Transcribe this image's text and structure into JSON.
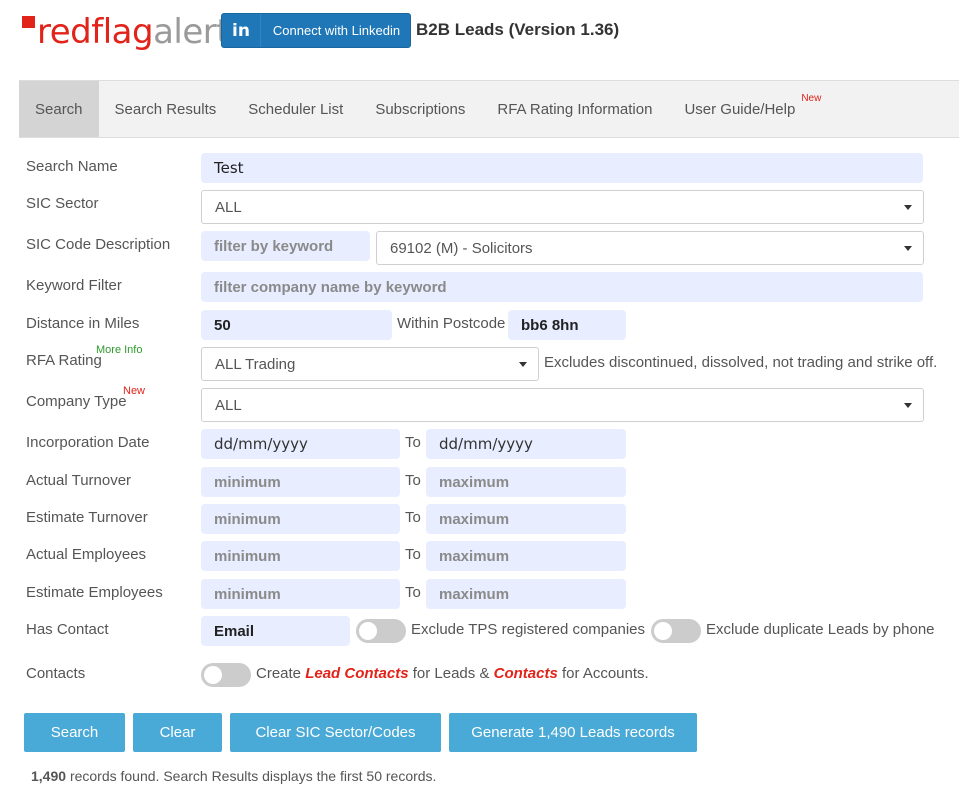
{
  "header": {
    "logo_red": "redflag",
    "logo_grey": "alert",
    "linkedin_icon": "in",
    "linkedin_label": "Connect with Linkedin",
    "app_title": "B2B Leads (Version 1.36)"
  },
  "tabs": [
    {
      "label": "Search",
      "active": true
    },
    {
      "label": "Search Results"
    },
    {
      "label": "Scheduler List"
    },
    {
      "label": "Subscriptions"
    },
    {
      "label": "RFA Rating Information"
    },
    {
      "label": "User Guide/Help",
      "badge": "New"
    }
  ],
  "form": {
    "search_name": {
      "label": "Search Name",
      "value": "Test"
    },
    "sic_sector": {
      "label": "SIC Sector",
      "value": "ALL"
    },
    "sic_code": {
      "label": "SIC Code Description",
      "filter_placeholder": "filter by keyword",
      "value": "69102 (M) - Solicitors"
    },
    "keyword": {
      "label": "Keyword Filter",
      "placeholder": "filter company name by keyword"
    },
    "distance": {
      "label": "Distance in Miles",
      "value": "50",
      "postcode_label": "Within Postcode",
      "postcode": "bb6 8hn"
    },
    "rfa_rating": {
      "label": "RFA Rating",
      "badge": "More Info",
      "value": "ALL Trading",
      "note": "Excludes discontinued, dissolved, not trading and strike off."
    },
    "company_type": {
      "label": "Company Type",
      "badge": "New",
      "value": "ALL"
    },
    "incorporation": {
      "label": "Incorporation Date",
      "from": "dd/mm/yyyy",
      "to_label": "To",
      "to": "dd/mm/yyyy"
    },
    "actual_turnover": {
      "label": "Actual Turnover",
      "min": "minimum",
      "to_label": "To",
      "max": "maximum"
    },
    "estimate_turnover": {
      "label": "Estimate Turnover",
      "min": "minimum",
      "to_label": "To",
      "max": "maximum"
    },
    "actual_employees": {
      "label": "Actual Employees",
      "min": "minimum",
      "to_label": "To",
      "max": "maximum"
    },
    "estimate_employees": {
      "label": "Estimate Employees",
      "min": "minimum",
      "to_label": "To",
      "max": "maximum"
    },
    "has_contact": {
      "label": "Has Contact",
      "value": "Email",
      "tps_label": "Exclude TPS registered companies",
      "dup_label": "Exclude duplicate Leads by phone"
    },
    "contacts": {
      "label": "Contacts",
      "text1": "Create",
      "em1": "Lead Contacts",
      "text2": "for Leads &",
      "em2": "Contacts",
      "text3": "for Accounts."
    }
  },
  "buttons": {
    "search": "Search",
    "clear": "Clear",
    "clear_sic": "Clear SIC Sector/Codes",
    "generate": "Generate 1,490 Leads records"
  },
  "footer": {
    "count": "1,490",
    "text": "records found. Search Results displays the first 50 records."
  }
}
